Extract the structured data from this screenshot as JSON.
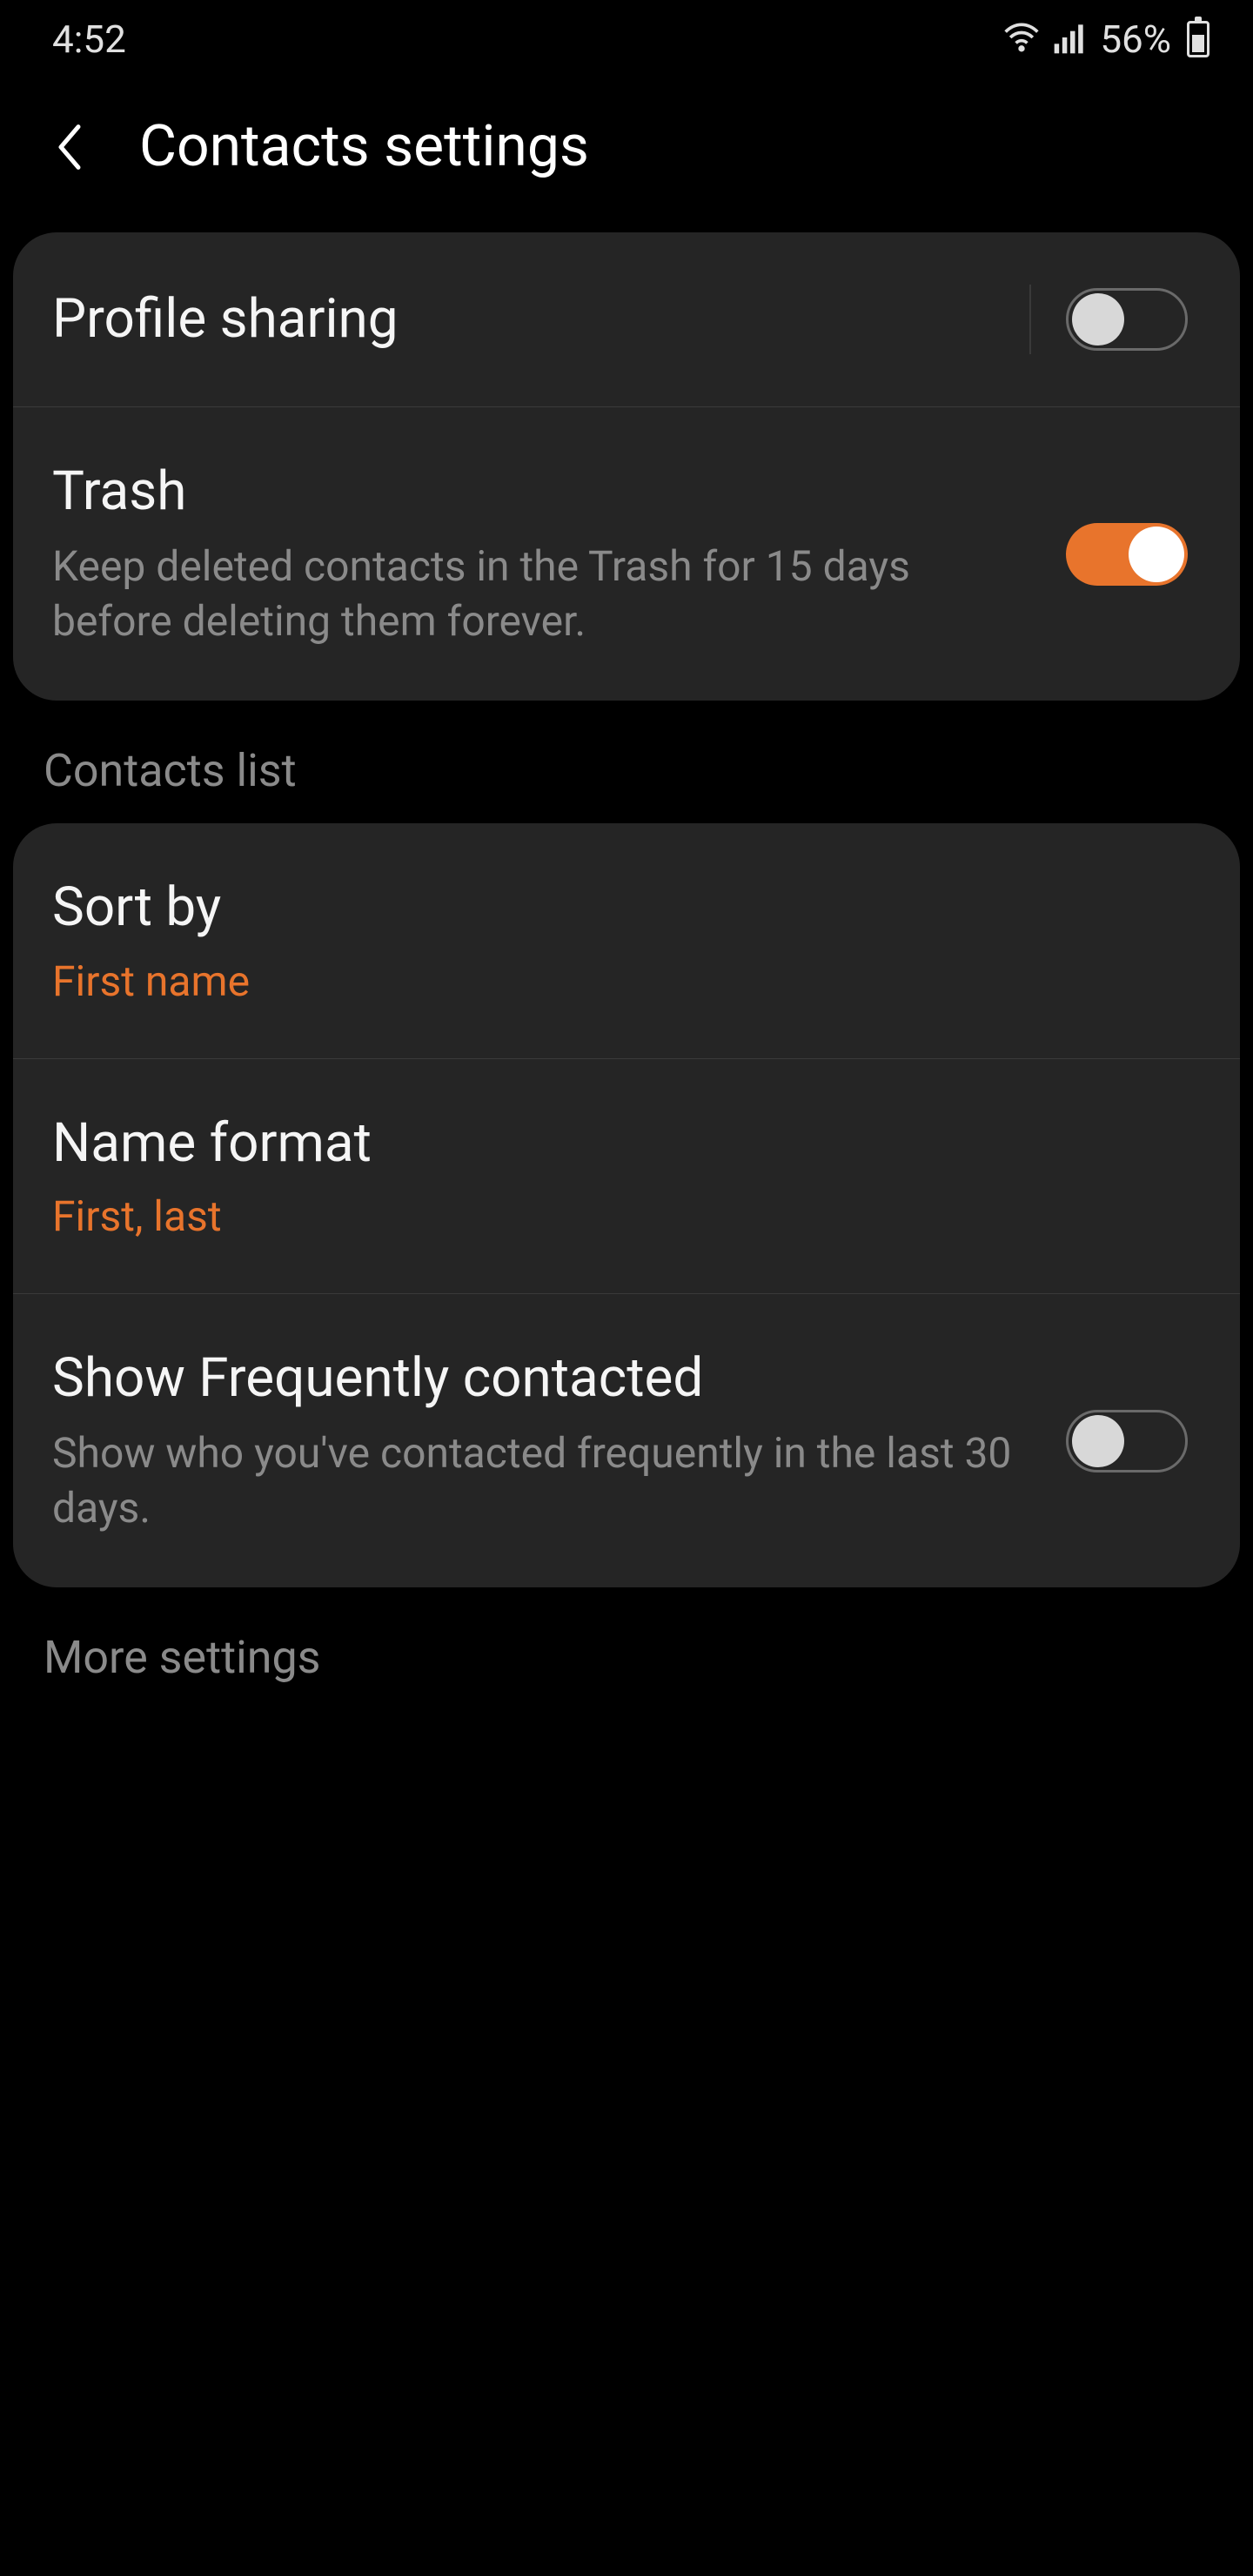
{
  "status": {
    "time": "4:52",
    "battery_percent": "56%"
  },
  "header": {
    "title": "Contacts settings"
  },
  "settings": {
    "profile_sharing": {
      "title": "Profile sharing"
    },
    "trash": {
      "title": "Trash",
      "desc": "Keep deleted contacts in the Trash for 15 days before deleting them forever."
    }
  },
  "sections": {
    "contacts_list": "Contacts list",
    "more_settings": "More settings"
  },
  "contacts_list": {
    "sort_by": {
      "title": "Sort by",
      "value": "First name"
    },
    "name_format": {
      "title": "Name format",
      "value": "First, last"
    },
    "frequently": {
      "title": "Show Frequently contacted",
      "desc": "Show who you've contacted frequently in the last 30 days."
    }
  }
}
